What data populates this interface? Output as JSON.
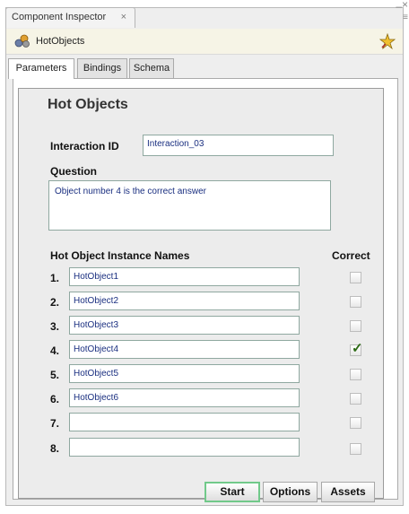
{
  "panel": {
    "tab_title": "Component Inspector",
    "tab_close_glyph": "×",
    "component_name": "HotObjects",
    "icons": {
      "component": "hot-objects-component-icon",
      "pin": "pin-icon",
      "tab_close": "close-icon",
      "window_minimize": "minimize-icon",
      "window_close": "close-icon",
      "window_menu": "panel-menu-icon"
    }
  },
  "window_controls": {
    "minimize": "–",
    "close": "×",
    "menu": "≡"
  },
  "tabs": [
    {
      "label": "Parameters",
      "active": true
    },
    {
      "label": "Bindings",
      "active": false
    },
    {
      "label": "Schema",
      "active": false
    }
  ],
  "form": {
    "title": "Hot Objects",
    "interaction_id_label": "Interaction ID",
    "interaction_id_value": "Interaction_03",
    "question_label": "Question",
    "question_value": "Object number 4 is the correct answer",
    "instances_header": "Hot Object Instance Names",
    "correct_header": "Correct",
    "rows": [
      {
        "num": "1.",
        "value": "HotObject1",
        "correct": false
      },
      {
        "num": "2.",
        "value": "HotObject2",
        "correct": false
      },
      {
        "num": "3.",
        "value": "HotObject3",
        "correct": false
      },
      {
        "num": "4.",
        "value": "HotObject4",
        "correct": true
      },
      {
        "num": "5.",
        "value": "HotObject5",
        "correct": false
      },
      {
        "num": "6.",
        "value": "HotObject6",
        "correct": false
      },
      {
        "num": "7.",
        "value": "",
        "correct": false
      },
      {
        "num": "8.",
        "value": "",
        "correct": false
      }
    ]
  },
  "buttons": {
    "start": "Start",
    "options": "Options",
    "assets": "Assets"
  },
  "colors": {
    "accent_green": "#71c98a",
    "field_text": "#1a2f80",
    "check": "#2c6a14"
  }
}
